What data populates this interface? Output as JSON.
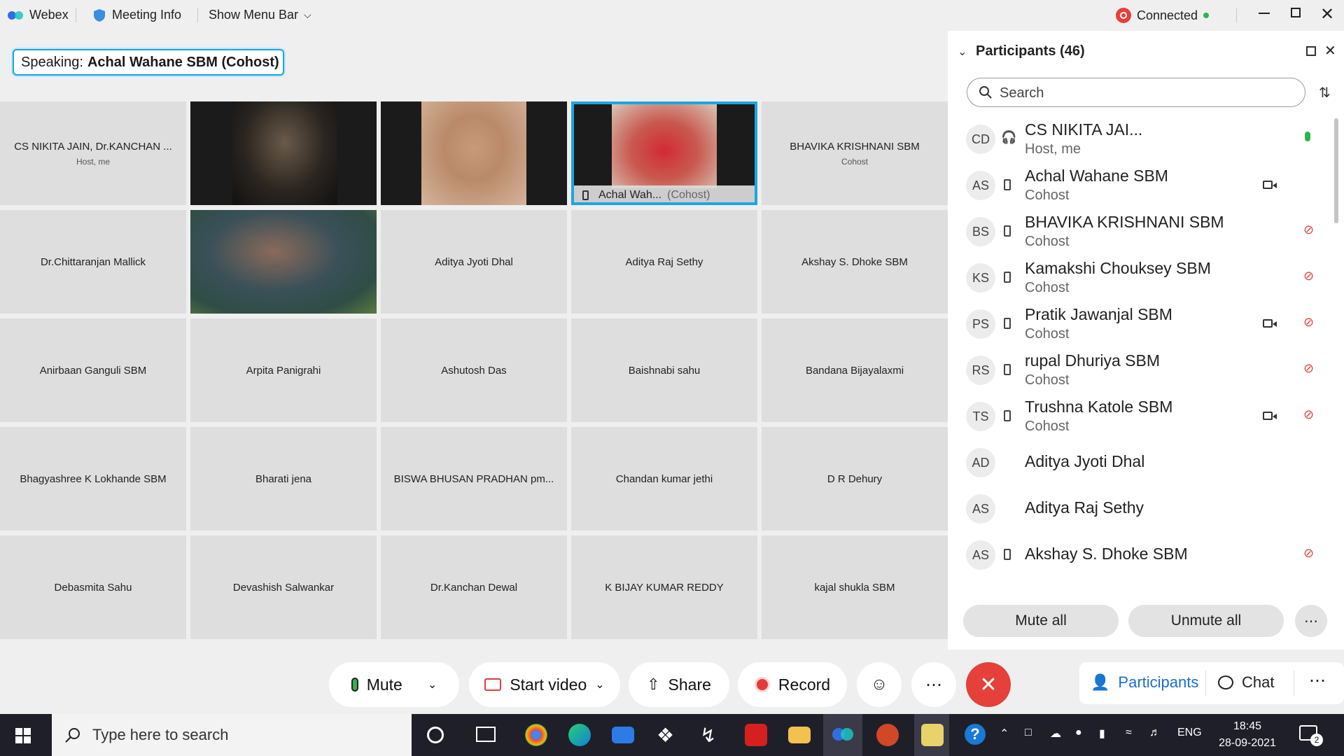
{
  "topbar": {
    "app_name": "Webex",
    "meeting_info": "Meeting Info",
    "show_menu_bar": "Show Menu Bar",
    "status": "Connected"
  },
  "speaking": {
    "label": "Speaking:",
    "name": "Achal Wahane SBM (Cohost)"
  },
  "grid": {
    "tiles": [
      {
        "name": "CS NIKITA JAIN, Dr.KANCHAN ...",
        "role": "Host, me"
      },
      {
        "name": "",
        "role": ""
      },
      {
        "name": "",
        "role": ""
      },
      {
        "name": "Achal Wah...",
        "role": "(Cohost)"
      },
      {
        "name": "BHAVIKA KRISHNANI SBM",
        "role": "Cohost"
      },
      {
        "name": "Dr.Chittaranjan Mallick",
        "role": ""
      },
      {
        "name": "",
        "role": ""
      },
      {
        "name": "Aditya Jyoti Dhal",
        "role": ""
      },
      {
        "name": "Aditya Raj Sethy",
        "role": ""
      },
      {
        "name": "Akshay S. Dhoke SBM",
        "role": ""
      },
      {
        "name": "Anirbaan Ganguli SBM",
        "role": ""
      },
      {
        "name": "Arpita Panigrahi",
        "role": ""
      },
      {
        "name": "Ashutosh Das",
        "role": ""
      },
      {
        "name": "Baishnabi sahu",
        "role": ""
      },
      {
        "name": "Bandana Bijayalaxmi",
        "role": ""
      },
      {
        "name": "Bhagyashree K Lokhande SBM",
        "role": ""
      },
      {
        "name": "Bharati jena",
        "role": ""
      },
      {
        "name": "BISWA BHUSAN PRADHAN pm...",
        "role": ""
      },
      {
        "name": "Chandan kumar jethi",
        "role": ""
      },
      {
        "name": "D R Dehury",
        "role": ""
      },
      {
        "name": "Debasmita Sahu",
        "role": ""
      },
      {
        "name": "Devashish Salwankar",
        "role": ""
      },
      {
        "name": "Dr.Kanchan Dewal",
        "role": ""
      },
      {
        "name": "K BIJAY KUMAR REDDY",
        "role": ""
      },
      {
        "name": "kajal shukla SBM",
        "role": ""
      }
    ]
  },
  "participants": {
    "title": "Participants (46)",
    "search_placeholder": "Search",
    "list": [
      {
        "initials": "CD",
        "name": "CS NIKITA JAI...",
        "role": "Host, me"
      },
      {
        "initials": "AS",
        "name": "Achal Wahane SBM",
        "role": "Cohost"
      },
      {
        "initials": "BS",
        "name": "BHAVIKA KRISHNANI SBM",
        "role": "Cohost"
      },
      {
        "initials": "KS",
        "name": "Kamakshi Chouksey SBM",
        "role": "Cohost"
      },
      {
        "initials": "PS",
        "name": "Pratik Jawanjal SBM",
        "role": "Cohost"
      },
      {
        "initials": "RS",
        "name": "rupal Dhuriya SBM",
        "role": "Cohost"
      },
      {
        "initials": "TS",
        "name": "Trushna Katole SBM",
        "role": "Cohost"
      },
      {
        "initials": "AD",
        "name": "Aditya Jyoti Dhal",
        "role": ""
      },
      {
        "initials": "AS",
        "name": "Aditya Raj Sethy",
        "role": ""
      },
      {
        "initials": "AS",
        "name": "Akshay S. Dhoke SBM",
        "role": ""
      }
    ],
    "mute_all": "Mute all",
    "unmute_all": "Unmute all"
  },
  "controls": {
    "mute": "Mute",
    "start_video": "Start video",
    "share": "Share",
    "record": "Record",
    "participants": "Participants",
    "chat": "Chat"
  },
  "taskbar": {
    "search_placeholder": "Type here to search",
    "lang": "ENG",
    "time": "18:45",
    "date": "28-09-2021",
    "notifications": "2"
  },
  "colors": {
    "accent": "#1aa6e6",
    "end_call": "#e5403a",
    "mic_green": "#2fb34a",
    "muted_red": "#e0443e",
    "record_red": "#e33b3b"
  }
}
